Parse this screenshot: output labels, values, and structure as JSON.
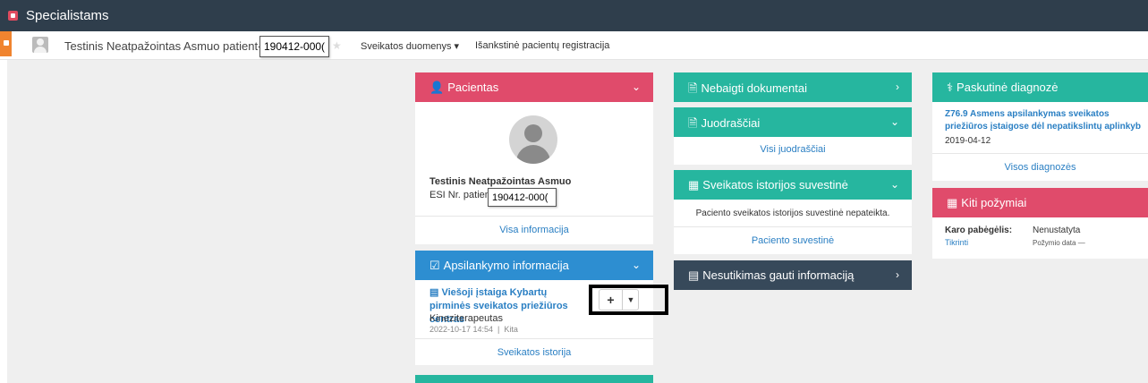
{
  "app": {
    "title": "Specialistams"
  },
  "patient_bar": {
    "name": "Testinis Neatpažointas Asmuo patient-",
    "id_value": "190412-000(",
    "nav": [
      "Sveikatos duomenys ▾",
      "Išankstinė pacientų registracija"
    ]
  },
  "pacientas": {
    "title": "Pacientas",
    "name": "Testinis Neatpažointas Asmuo",
    "esi_label": "ESI Nr. patient-",
    "esi_value": "190412-000(",
    "link": "Visa informacija"
  },
  "apsilankymo": {
    "title": "Apsilankymo informacija",
    "institution": "Viešoji įstaiga Kybartų pirminės sveikatos priežiūros centras",
    "specialty": "Kineziterapeutas",
    "meta": "2022-10-17 14:54  |  Kita",
    "link": "Sveikatos istorija",
    "add_label": "+"
  },
  "nebaigti": {
    "title": "Nebaigti dokumentai"
  },
  "juodrasciai": {
    "title": "Juodraščiai",
    "link": "Visi juodraščiai"
  },
  "suvestine": {
    "title": "Sveikatos istorijos suvestinė",
    "message": "Paciento sveikatos istorijos suvestinė nepateikta.",
    "link": "Paciento suvestinė"
  },
  "nesutikimas": {
    "title": "Nesutikimas gauti informaciją"
  },
  "diagnoze": {
    "title": "Paskutinė diagnozė",
    "text": "Z76.9 Asmens apsilankymas sveikatos priežiūros įstaigose dėl nepatikslintų aplinkyb",
    "date": "2019-04-12",
    "link": "Visos diagnozės"
  },
  "kiti": {
    "title": "Kiti požymiai",
    "label": "Karo pabėgėlis:",
    "value": "Nenustatyta",
    "check_link": "Tikrinti",
    "date_label": "Požymio data —"
  },
  "colors": {
    "red": "#e04b6b",
    "teal": "#26b69f",
    "blue": "#2d8ed1",
    "navy": "#37495a",
    "topbar": "#2f3e4c"
  }
}
